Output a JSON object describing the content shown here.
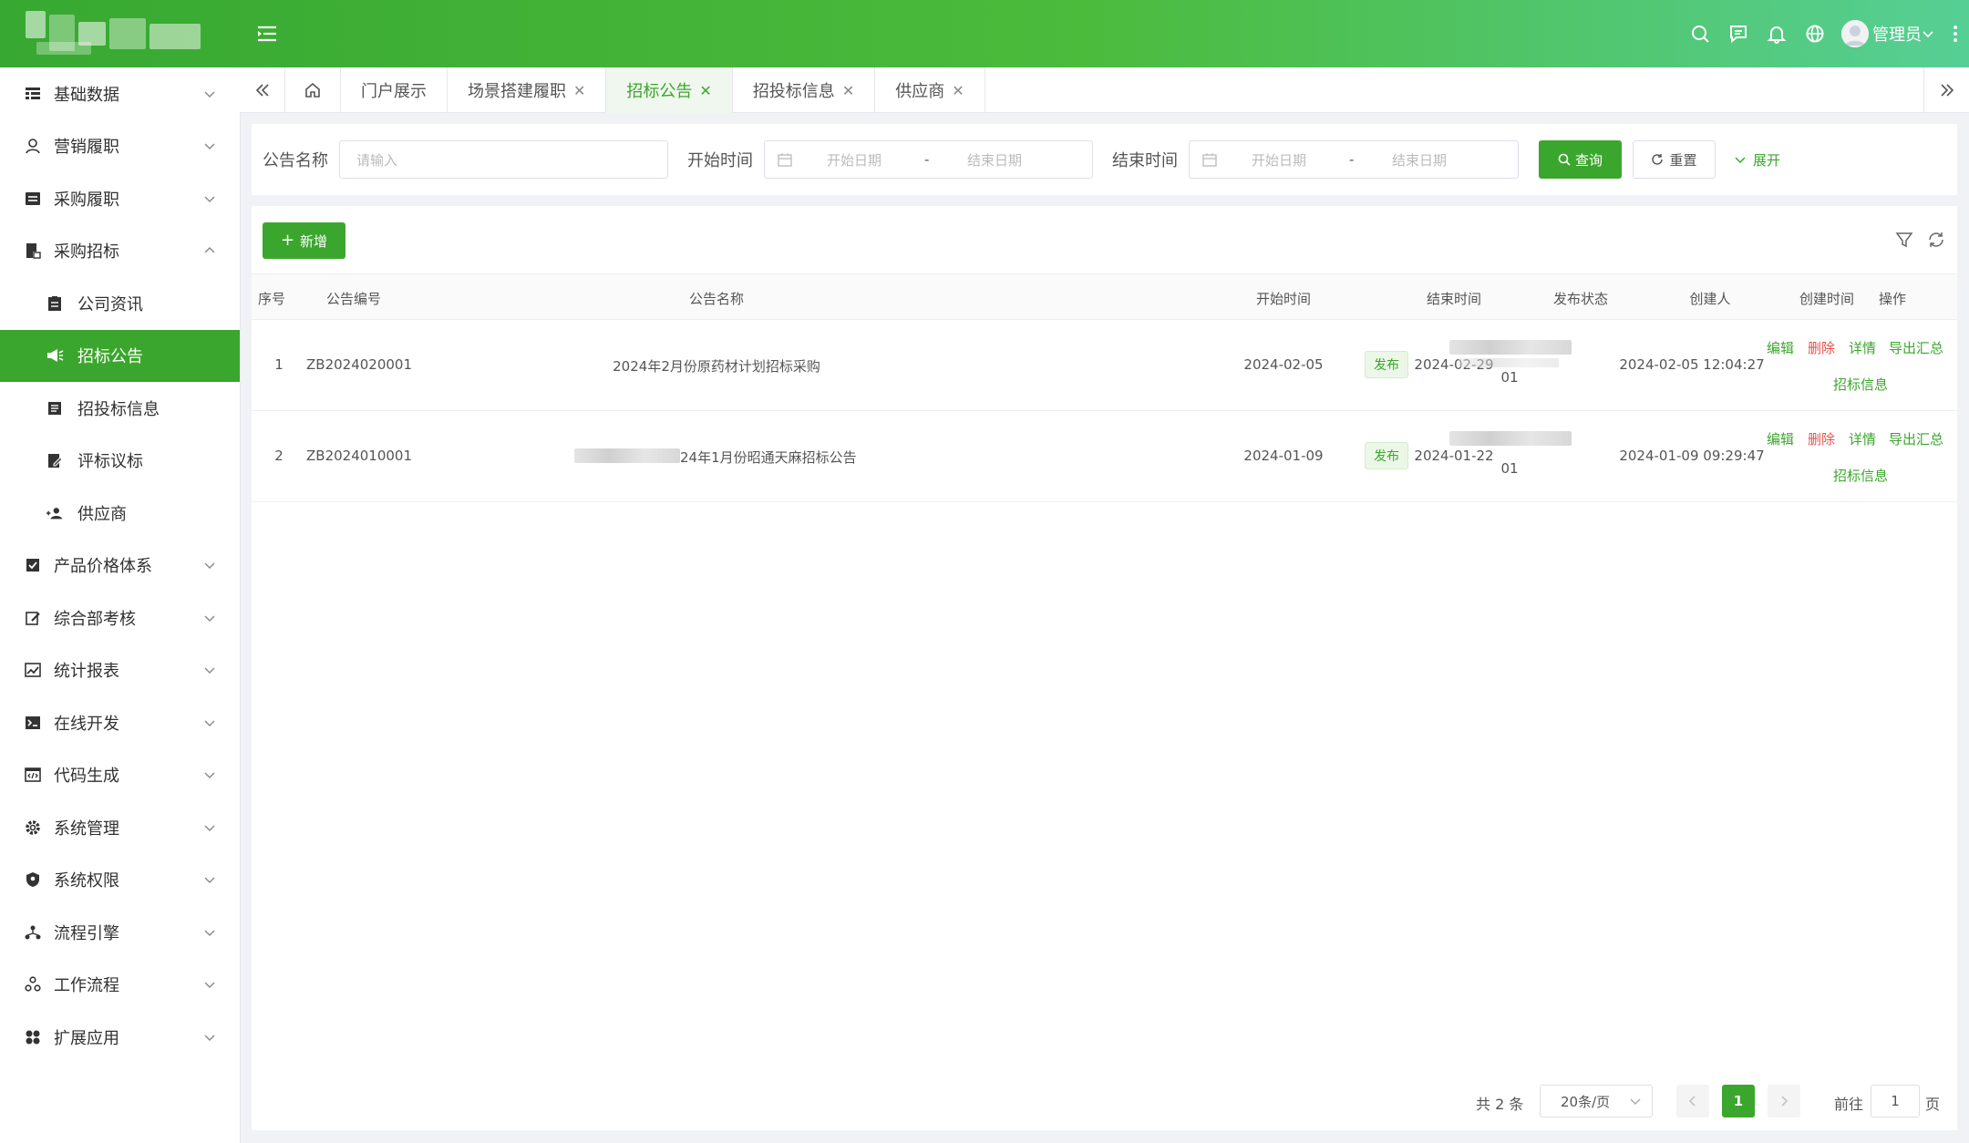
{
  "header": {
    "user_name": "管理员",
    "icons": [
      "search-icon",
      "message-icon",
      "bell-icon",
      "globe-icon"
    ],
    "gradient": [
      "#37a831",
      "#56cf95"
    ]
  },
  "sidebar": {
    "items": [
      {
        "label": "基础数据",
        "icon": "table-icon"
      },
      {
        "label": "营销履职",
        "icon": "user-icon"
      },
      {
        "label": "采购履职",
        "icon": "swap-icon"
      },
      {
        "label": "采购招标",
        "icon": "document-icon"
      },
      {
        "label": "公司资讯",
        "icon": "clipboard-icon"
      },
      {
        "label": "招标公告",
        "icon": "megaphone-icon"
      },
      {
        "label": "招投标信息",
        "icon": "list-icon"
      },
      {
        "label": "评标议标",
        "icon": "edit-doc-icon"
      },
      {
        "label": "供应商",
        "icon": "people-icon"
      },
      {
        "label": "产品价格体系",
        "icon": "checkbox-icon"
      },
      {
        "label": "综合部考核",
        "icon": "pen-icon"
      },
      {
        "label": "统计报表",
        "icon": "chart-icon"
      },
      {
        "label": "在线开发",
        "icon": "terminal-icon"
      },
      {
        "label": "代码生成",
        "icon": "code-icon"
      },
      {
        "label": "系统管理",
        "icon": "gear-icon"
      },
      {
        "label": "系统权限",
        "icon": "shield-icon"
      },
      {
        "label": "流程引擎",
        "icon": "flow-icon"
      },
      {
        "label": "工作流程",
        "icon": "workflow-icon"
      },
      {
        "label": "扩展应用",
        "icon": "apps-icon"
      }
    ]
  },
  "tabs": [
    "门户展示",
    "场景搭建履职",
    "招标公告",
    "招投标信息",
    "供应商"
  ],
  "search": {
    "name_label": "公告名称",
    "name_placeholder": "请输入",
    "start_label": "开始时间",
    "end_label": "结束时间",
    "start_date_placeholder": "开始日期",
    "end_date_placeholder": "结束日期",
    "range_sep": "-",
    "query_button": "查询",
    "reset_button": "重置",
    "expand_label": "展开"
  },
  "toolbar": {
    "add_button": "新增"
  },
  "table": {
    "columns": [
      "序号",
      "公告编号",
      "公告名称",
      "开始时间",
      "结束时间",
      "发布状态",
      "创建人",
      "创建时间",
      "操作"
    ],
    "rows": [
      {
        "index": "1",
        "code": "ZB2024020001",
        "name": "2024年2月份原药材计划招标采购",
        "start": "2024-02-05",
        "end": "2024-02-29",
        "status": "发布",
        "creator_suffix": "01",
        "created": "2024-02-05 12:04:27"
      },
      {
        "index": "2",
        "code": "ZB2024010001",
        "name": "24年1月份昭通天麻招标公告",
        "start": "2024-01-09",
        "end": "2024-01-22",
        "status": "发布",
        "creator_suffix": "01",
        "created": "2024-01-09 09:29:47"
      }
    ],
    "actions": {
      "edit": "编辑",
      "delete": "删除",
      "detail": "详情",
      "export": "导出汇总",
      "bid_info": "招标信息"
    }
  },
  "pagination": {
    "total": "共 2 条",
    "page_size": "20条/页",
    "current_page": "1",
    "goto_label": "前往",
    "goto_value": "1",
    "page_unit": "页"
  },
  "colors": {
    "primary": "#3ba62d",
    "danger": "#e5534b"
  }
}
